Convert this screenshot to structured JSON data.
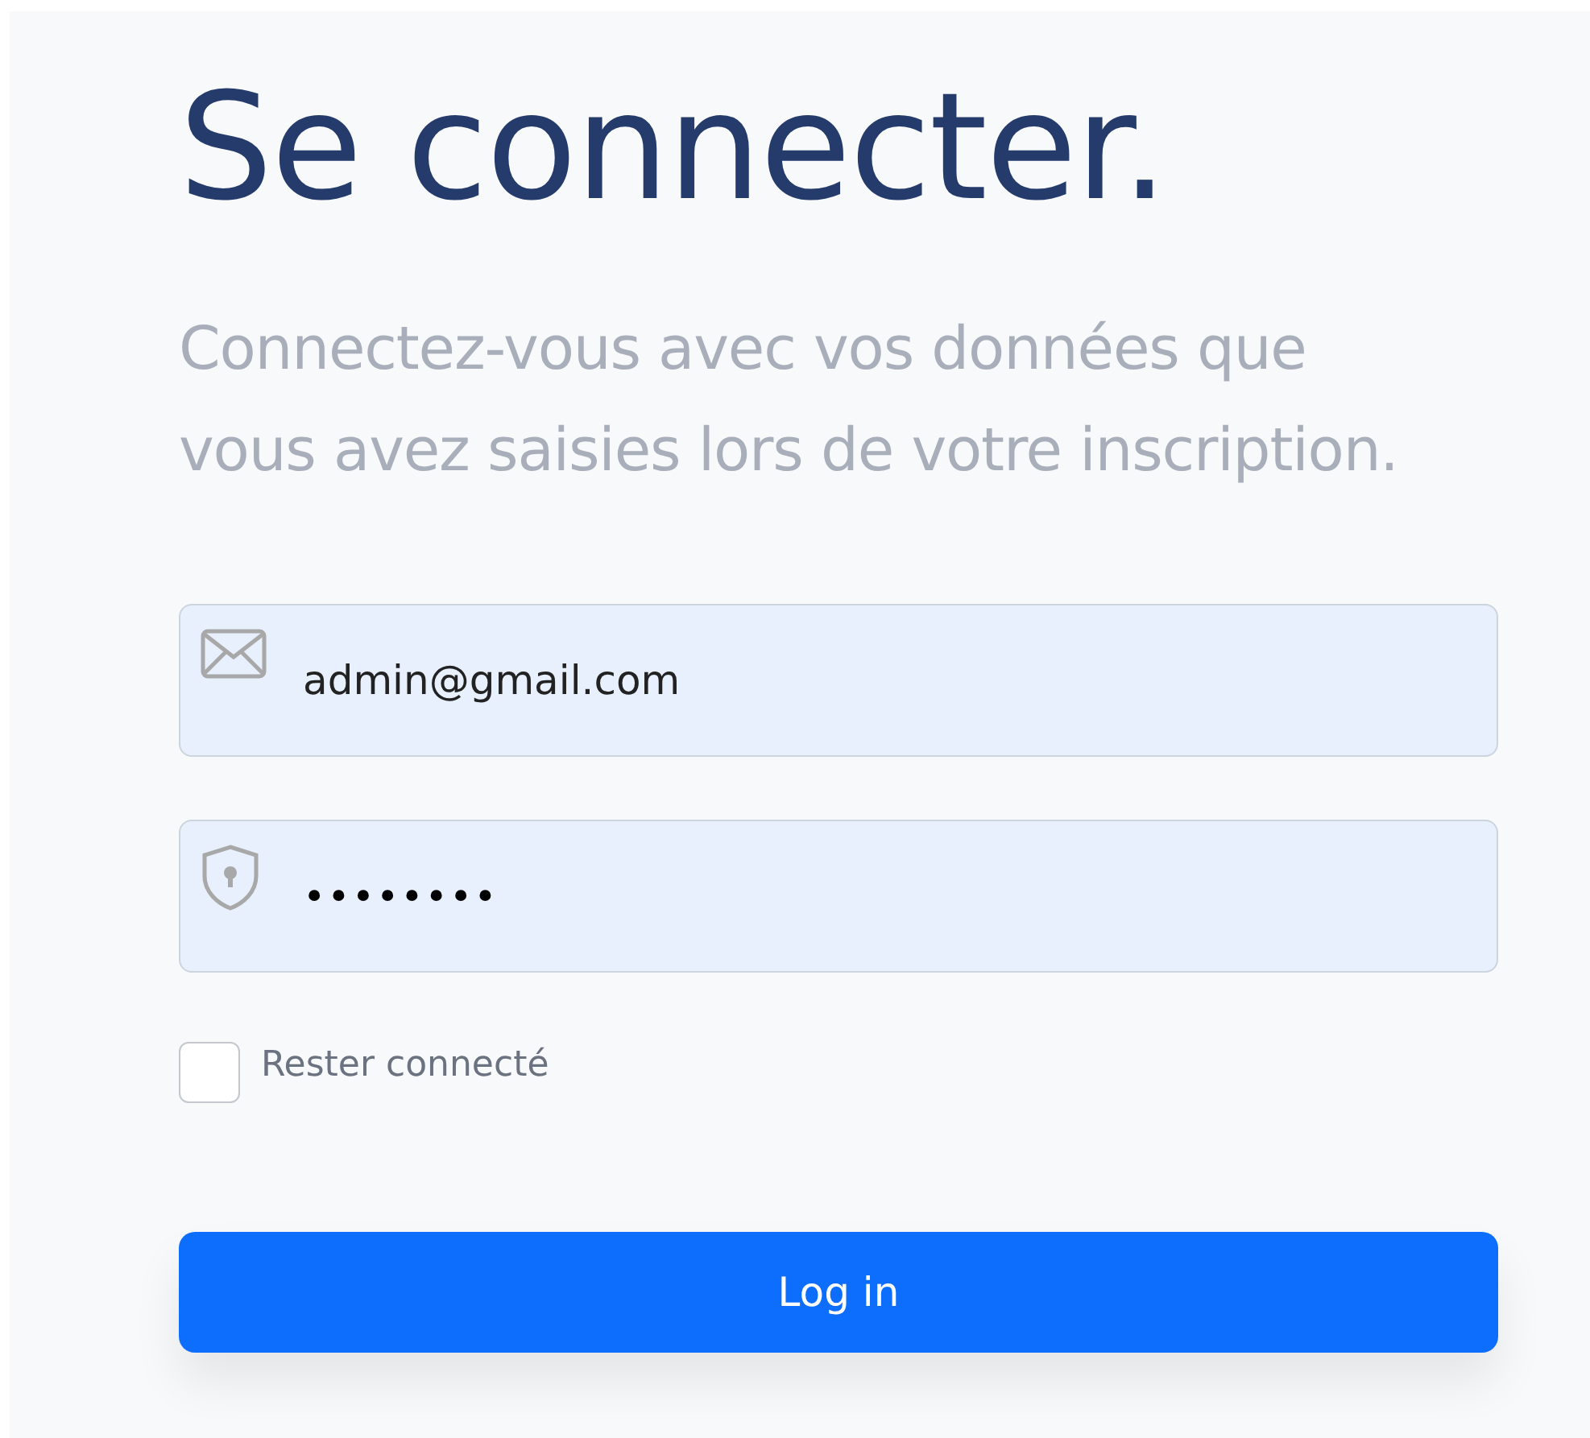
{
  "title": "Se connecter.",
  "subtitle": "Connectez-vous avec vos données que vous avez saisies lors de votre inscription.",
  "fields": [
    {
      "kind": "email",
      "value": "admin@gmail.com"
    },
    {
      "kind": "password",
      "value": "••••••••"
    }
  ],
  "remember": {
    "label": "Rester connecté",
    "checked": false
  },
  "button": "Log in"
}
